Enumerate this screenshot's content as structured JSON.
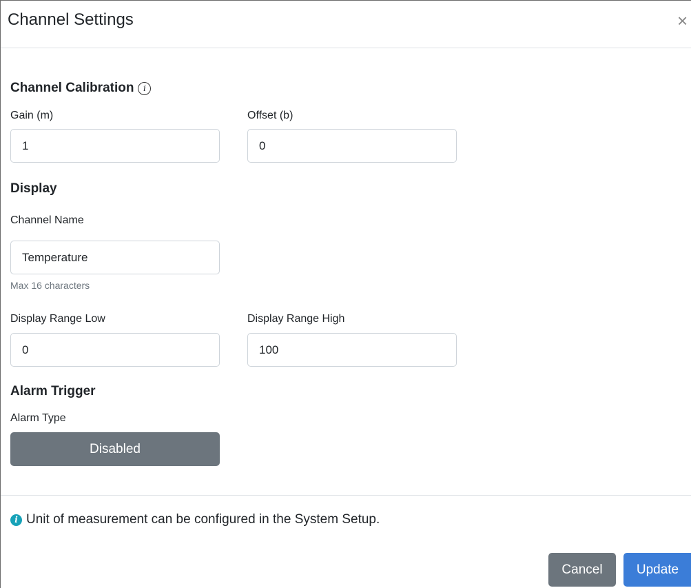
{
  "header": {
    "title": "Channel Settings",
    "close_icon": "×"
  },
  "calibration": {
    "title": "Channel Calibration",
    "info_icon": "i",
    "gain_label": "Gain (m)",
    "gain_value": "1",
    "offset_label": "Offset (b)",
    "offset_value": "0"
  },
  "display": {
    "title": "Display",
    "channel_name_label": "Channel Name",
    "channel_name_value": "Temperature",
    "channel_name_help": "Max 16 characters",
    "range_low_label": "Display Range Low",
    "range_low_value": "0",
    "range_high_label": "Display Range High",
    "range_high_value": "100"
  },
  "alarm": {
    "title": "Alarm Trigger",
    "type_label": "Alarm Type",
    "type_value": "Disabled"
  },
  "footer": {
    "info_icon": "i",
    "note": "Unit of measurement can be configured in the System Setup.",
    "cancel_label": "Cancel",
    "update_label": "Update"
  },
  "colors": {
    "secondary": "#6c757d",
    "primary": "#3b7dd8",
    "info": "#17a2b8"
  }
}
